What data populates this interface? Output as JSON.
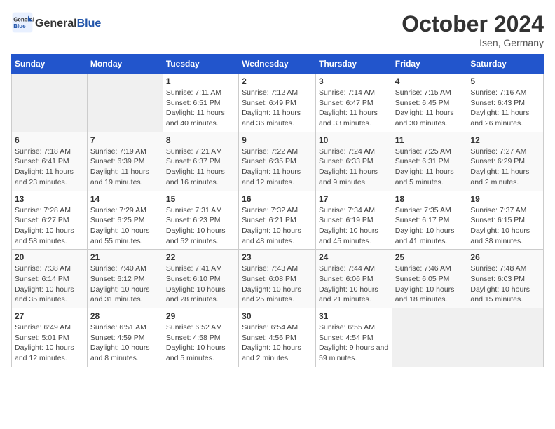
{
  "header": {
    "logo_general": "General",
    "logo_blue": "Blue",
    "month_title": "October 2024",
    "location": "Isen, Germany"
  },
  "calendar": {
    "headers": [
      "Sunday",
      "Monday",
      "Tuesday",
      "Wednesday",
      "Thursday",
      "Friday",
      "Saturday"
    ],
    "weeks": [
      [
        {
          "day": "",
          "info": ""
        },
        {
          "day": "",
          "info": ""
        },
        {
          "day": "1",
          "info": "Sunrise: 7:11 AM\nSunset: 6:51 PM\nDaylight: 11 hours and 40 minutes."
        },
        {
          "day": "2",
          "info": "Sunrise: 7:12 AM\nSunset: 6:49 PM\nDaylight: 11 hours and 36 minutes."
        },
        {
          "day": "3",
          "info": "Sunrise: 7:14 AM\nSunset: 6:47 PM\nDaylight: 11 hours and 33 minutes."
        },
        {
          "day": "4",
          "info": "Sunrise: 7:15 AM\nSunset: 6:45 PM\nDaylight: 11 hours and 30 minutes."
        },
        {
          "day": "5",
          "info": "Sunrise: 7:16 AM\nSunset: 6:43 PM\nDaylight: 11 hours and 26 minutes."
        }
      ],
      [
        {
          "day": "6",
          "info": "Sunrise: 7:18 AM\nSunset: 6:41 PM\nDaylight: 11 hours and 23 minutes."
        },
        {
          "day": "7",
          "info": "Sunrise: 7:19 AM\nSunset: 6:39 PM\nDaylight: 11 hours and 19 minutes."
        },
        {
          "day": "8",
          "info": "Sunrise: 7:21 AM\nSunset: 6:37 PM\nDaylight: 11 hours and 16 minutes."
        },
        {
          "day": "9",
          "info": "Sunrise: 7:22 AM\nSunset: 6:35 PM\nDaylight: 11 hours and 12 minutes."
        },
        {
          "day": "10",
          "info": "Sunrise: 7:24 AM\nSunset: 6:33 PM\nDaylight: 11 hours and 9 minutes."
        },
        {
          "day": "11",
          "info": "Sunrise: 7:25 AM\nSunset: 6:31 PM\nDaylight: 11 hours and 5 minutes."
        },
        {
          "day": "12",
          "info": "Sunrise: 7:27 AM\nSunset: 6:29 PM\nDaylight: 11 hours and 2 minutes."
        }
      ],
      [
        {
          "day": "13",
          "info": "Sunrise: 7:28 AM\nSunset: 6:27 PM\nDaylight: 10 hours and 58 minutes."
        },
        {
          "day": "14",
          "info": "Sunrise: 7:29 AM\nSunset: 6:25 PM\nDaylight: 10 hours and 55 minutes."
        },
        {
          "day": "15",
          "info": "Sunrise: 7:31 AM\nSunset: 6:23 PM\nDaylight: 10 hours and 52 minutes."
        },
        {
          "day": "16",
          "info": "Sunrise: 7:32 AM\nSunset: 6:21 PM\nDaylight: 10 hours and 48 minutes."
        },
        {
          "day": "17",
          "info": "Sunrise: 7:34 AM\nSunset: 6:19 PM\nDaylight: 10 hours and 45 minutes."
        },
        {
          "day": "18",
          "info": "Sunrise: 7:35 AM\nSunset: 6:17 PM\nDaylight: 10 hours and 41 minutes."
        },
        {
          "day": "19",
          "info": "Sunrise: 7:37 AM\nSunset: 6:15 PM\nDaylight: 10 hours and 38 minutes."
        }
      ],
      [
        {
          "day": "20",
          "info": "Sunrise: 7:38 AM\nSunset: 6:14 PM\nDaylight: 10 hours and 35 minutes."
        },
        {
          "day": "21",
          "info": "Sunrise: 7:40 AM\nSunset: 6:12 PM\nDaylight: 10 hours and 31 minutes."
        },
        {
          "day": "22",
          "info": "Sunrise: 7:41 AM\nSunset: 6:10 PM\nDaylight: 10 hours and 28 minutes."
        },
        {
          "day": "23",
          "info": "Sunrise: 7:43 AM\nSunset: 6:08 PM\nDaylight: 10 hours and 25 minutes."
        },
        {
          "day": "24",
          "info": "Sunrise: 7:44 AM\nSunset: 6:06 PM\nDaylight: 10 hours and 21 minutes."
        },
        {
          "day": "25",
          "info": "Sunrise: 7:46 AM\nSunset: 6:05 PM\nDaylight: 10 hours and 18 minutes."
        },
        {
          "day": "26",
          "info": "Sunrise: 7:48 AM\nSunset: 6:03 PM\nDaylight: 10 hours and 15 minutes."
        }
      ],
      [
        {
          "day": "27",
          "info": "Sunrise: 6:49 AM\nSunset: 5:01 PM\nDaylight: 10 hours and 12 minutes."
        },
        {
          "day": "28",
          "info": "Sunrise: 6:51 AM\nSunset: 4:59 PM\nDaylight: 10 hours and 8 minutes."
        },
        {
          "day": "29",
          "info": "Sunrise: 6:52 AM\nSunset: 4:58 PM\nDaylight: 10 hours and 5 minutes."
        },
        {
          "day": "30",
          "info": "Sunrise: 6:54 AM\nSunset: 4:56 PM\nDaylight: 10 hours and 2 minutes."
        },
        {
          "day": "31",
          "info": "Sunrise: 6:55 AM\nSunset: 4:54 PM\nDaylight: 9 hours and 59 minutes."
        },
        {
          "day": "",
          "info": ""
        },
        {
          "day": "",
          "info": ""
        }
      ]
    ]
  }
}
